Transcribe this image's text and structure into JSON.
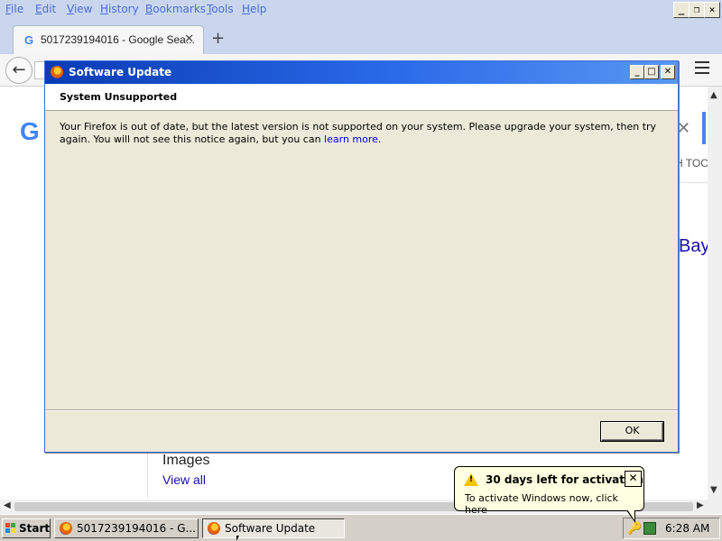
{
  "browser": {
    "menus": [
      "File",
      "Edit",
      "View",
      "History",
      "Bookmarks",
      "Tools",
      "Help"
    ],
    "window_controls": {
      "minimize": "_",
      "restore": "❐",
      "close": "✕"
    },
    "tab": {
      "favicon": "G",
      "title": "5017239194016 - Google Sea...",
      "close": "✕"
    },
    "new_tab": "+",
    "back": "←",
    "menu_icon": "hamburger-icon"
  },
  "page": {
    "logo_fragment": "G",
    "search_close": "✕",
    "toc_fragment": "H TOC",
    "ebay_fragment": "Bay",
    "images_heading": "Images",
    "images_link": "View all"
  },
  "dialog": {
    "title": "Software Update",
    "heading": "System Unsupported",
    "message": "Your Firefox is out of date, but the latest version is not supported on your system. Please upgrade your system, then try again. You will not see this notice again, but you can ",
    "link_text": "learn more",
    "message_end": ".",
    "ok_label": "OK",
    "controls": {
      "minimize": "_",
      "maximize": "□",
      "close": "✕"
    }
  },
  "taskbar": {
    "start_label": "Start",
    "buttons": [
      {
        "label": "5017239194016 - G..."
      },
      {
        "label": "Software Update"
      }
    ],
    "clock": "6:28 AM"
  },
  "balloon": {
    "title": "30 days left for activation",
    "text": "To activate Windows now, click here",
    "close": "✕"
  },
  "colors": {
    "titlebar": "#0a3cb4",
    "dialog_face": "#ece9d8",
    "google_blue": "#4285f4",
    "balloon_bg": "#ffffe1"
  }
}
